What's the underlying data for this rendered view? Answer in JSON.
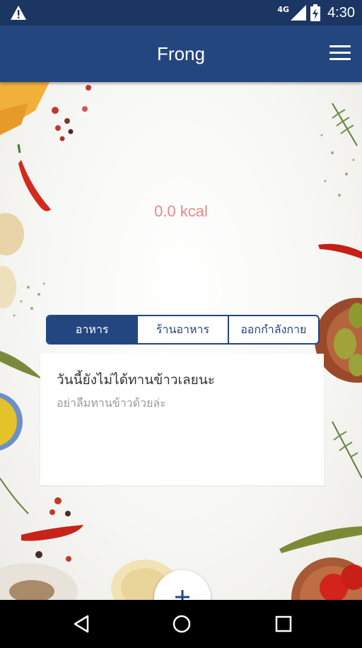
{
  "status_bar": {
    "network": "4G",
    "time": "4:30",
    "icons": [
      "warning-icon",
      "signal-icon",
      "battery-charging-icon"
    ]
  },
  "app_bar": {
    "title": "Frong",
    "menu_icon": "hamburger-menu-icon"
  },
  "summary": {
    "calories": "0.0 kcal"
  },
  "tabs": [
    {
      "label": "อาหาร",
      "active": true
    },
    {
      "label": "ร้านอาหาร",
      "active": false
    },
    {
      "label": "ออกกำลังกาย",
      "active": false
    }
  ],
  "empty_card": {
    "title": "วันนี้ยังไม่ได้ทานข้าวเลยนะ",
    "subtitle": "อย่าลืมทานข้าวด้วยล่ะ"
  },
  "fab": {
    "icon": "plus-icon"
  },
  "nav_bar": {
    "icons": [
      "back-icon",
      "home-icon",
      "recents-icon"
    ]
  },
  "colors": {
    "primary": "#24467f",
    "status_bar": "#1c3663",
    "kcal_text": "#e88a84"
  }
}
